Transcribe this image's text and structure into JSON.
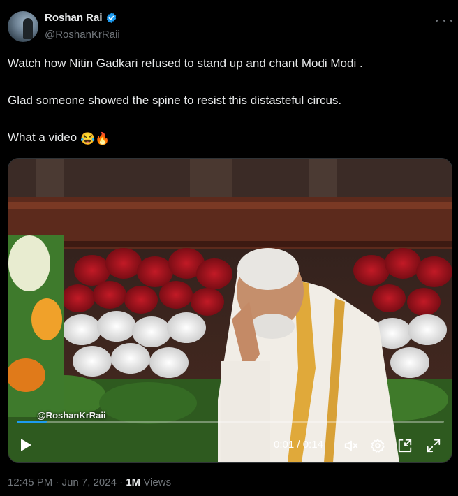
{
  "author": {
    "name": "Roshan Rai",
    "handle": "@RoshanKrRaii",
    "verified": true
  },
  "tweet": {
    "lines": [
      "Watch how Nitin Gadkari refused to stand up and chant Modi Modi .",
      "Glad someone showed the spine to resist this distasteful circus.",
      "What a video"
    ],
    "emojis": [
      "😂",
      "🔥"
    ]
  },
  "video": {
    "watermark": "@RoshanKrRaii",
    "time_current": "0:01",
    "time_total": "0:14",
    "time_separator": " / ",
    "progress": 0.07
  },
  "footer": {
    "time": "12:45 PM",
    "date": "Jun 7, 2024",
    "views_count": "1M",
    "views_label": "Views"
  },
  "colors": {
    "background": "#000000",
    "text": "#e7e9ea",
    "muted": "#71767b",
    "accent": "#1d9bf0"
  }
}
